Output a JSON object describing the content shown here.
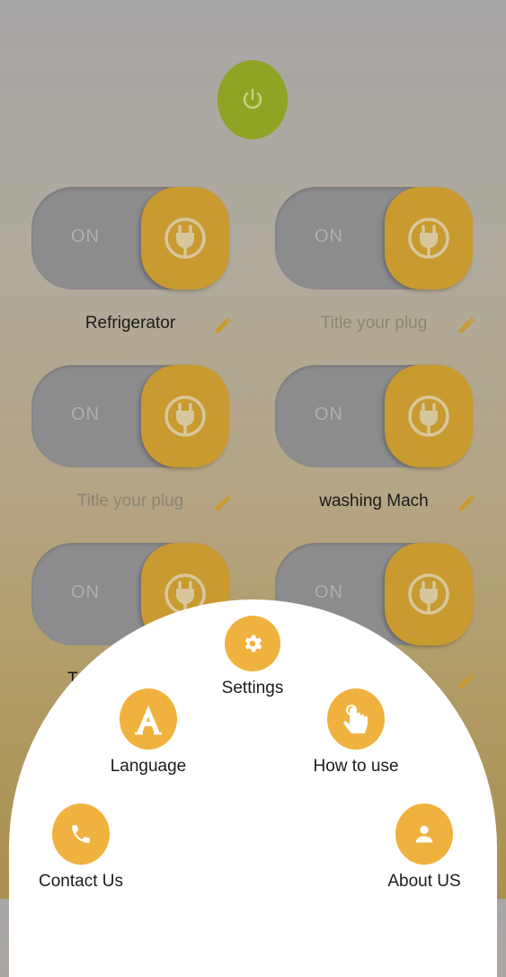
{
  "power": {
    "icon": "power-icon"
  },
  "plugs": [
    {
      "state_label": "ON",
      "title": "Refrigerator",
      "placeholder": false
    },
    {
      "state_label": "ON",
      "title": "Title your plug",
      "placeholder": true
    },
    {
      "state_label": "ON",
      "title": "Title your plug",
      "placeholder": true
    },
    {
      "state_label": "ON",
      "title": "washing Mach",
      "placeholder": false
    },
    {
      "state_label": "ON",
      "title": "Te",
      "placeholder": false
    },
    {
      "state_label": "ON",
      "title": "",
      "placeholder": true
    }
  ],
  "menu": {
    "settings": "Settings",
    "language": "Language",
    "how_to_use": "How to use",
    "contact_us": "Contact Us",
    "about_us": "About US"
  },
  "colors": {
    "accent": "#f0b23e",
    "knob": "#c89a30",
    "power": "#8fa424",
    "toggle_track": "#8c8b8d"
  }
}
